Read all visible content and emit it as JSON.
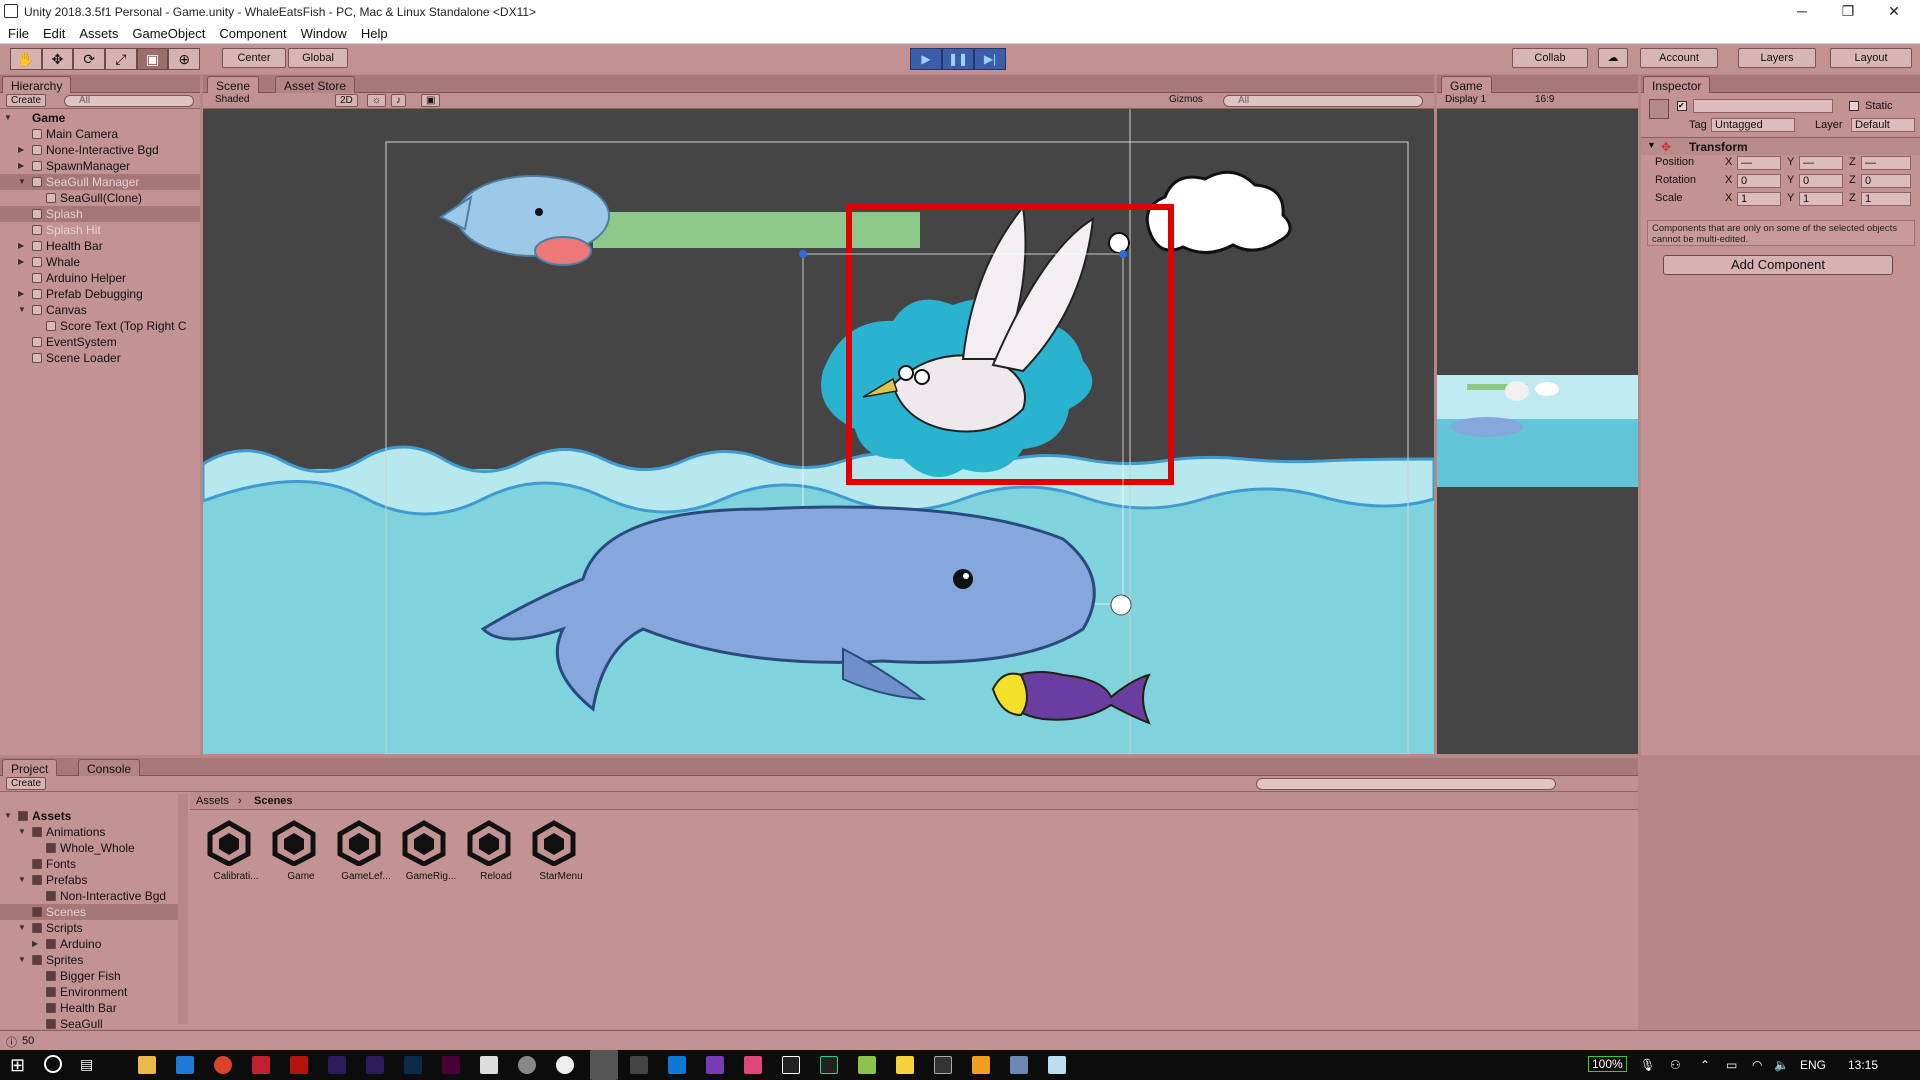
{
  "titlebar": {
    "title": "Unity 2018.3.5f1 Personal - Game.unity - WhaleEatsFish - PC, Mac & Linux Standalone <DX11>",
    "minimize": "─",
    "restore": "❐",
    "close": "✕"
  },
  "menu": [
    "File",
    "Edit",
    "Assets",
    "GameObject",
    "Component",
    "Window",
    "Help"
  ],
  "toolbar": {
    "tools": [
      "✋",
      "✥",
      "⟳",
      "⤢",
      "▣",
      "⊕"
    ],
    "center": "Center",
    "global": "Global",
    "play": "▶",
    "pause": "❚❚",
    "step": "▶|",
    "collab": "Collab",
    "account": "Account",
    "layers": "Layers",
    "layout": "Layout"
  },
  "hierarchy": {
    "tab": "Hierarchy",
    "create": "Create",
    "search_placeholder": "All",
    "scene": "Game",
    "items": [
      {
        "label": "Main Camera",
        "depth": 1,
        "arrow": ""
      },
      {
        "label": "None-Interactive Bgd",
        "depth": 1,
        "arrow": "▶"
      },
      {
        "label": "SpawnManager",
        "depth": 1,
        "arrow": "▶"
      },
      {
        "label": "SeaGull Manager",
        "depth": 1,
        "arrow": "▼",
        "selected": true,
        "grey": true
      },
      {
        "label": "SeaGull(Clone)",
        "depth": 2,
        "arrow": ""
      },
      {
        "label": "Splash",
        "depth": 1,
        "arrow": "",
        "selected": true,
        "grey": true
      },
      {
        "label": "Splash Hit",
        "depth": 1,
        "arrow": "",
        "grey": true
      },
      {
        "label": "Health Bar",
        "depth": 1,
        "arrow": "▶"
      },
      {
        "label": "Whale",
        "depth": 1,
        "arrow": "▶"
      },
      {
        "label": "Arduino Helper",
        "depth": 1,
        "arrow": ""
      },
      {
        "label": "Prefab Debugging",
        "depth": 1,
        "arrow": "▶"
      },
      {
        "label": "Canvas",
        "depth": 1,
        "arrow": "▼"
      },
      {
        "label": "Score Text (Top Right C",
        "depth": 2,
        "arrow": ""
      },
      {
        "label": "EventSystem",
        "depth": 1,
        "arrow": ""
      },
      {
        "label": "Scene Loader",
        "depth": 1,
        "arrow": ""
      }
    ]
  },
  "scene": {
    "tab": "Scene",
    "tab2": "Asset Store",
    "shading": "Shaded",
    "mode2d": "2D",
    "gizmos": "Gizmos",
    "search_placeholder": "All"
  },
  "game": {
    "tab": "Game",
    "display": "Display 1",
    "aspect": "16:9"
  },
  "inspector": {
    "tab": "Inspector",
    "static": "Static",
    "tag_label": "Tag",
    "tag": "Untagged",
    "layer_label": "Layer",
    "layer": "Default",
    "transform": "Transform",
    "rows": [
      {
        "label": "Position",
        "x": "—",
        "y": "—",
        "z": "—"
      },
      {
        "label": "Rotation",
        "x": "0",
        "y": "0",
        "z": "0"
      },
      {
        "label": "Scale",
        "x": "1",
        "y": "1",
        "z": "1"
      }
    ],
    "axes": {
      "x": "X",
      "y": "Y",
      "z": "Z"
    },
    "note": "Components that are only on some of the selected objects cannot be multi-edited.",
    "add_component": "Add Component"
  },
  "project": {
    "tab": "Project",
    "tab2": "Console",
    "create": "Create",
    "tree": [
      {
        "label": "Assets",
        "depth": 0,
        "arrow": "▼",
        "bold": true
      },
      {
        "label": "Animations",
        "depth": 1,
        "arrow": "▼"
      },
      {
        "label": "Whole_Whole",
        "depth": 2,
        "arrow": ""
      },
      {
        "label": "Fonts",
        "depth": 1,
        "arrow": ""
      },
      {
        "label": "Prefabs",
        "depth": 1,
        "arrow": "▼"
      },
      {
        "label": "Non-Interactive Bgd",
        "depth": 2,
        "arrow": ""
      },
      {
        "label": "Scenes",
        "depth": 1,
        "arrow": "",
        "selected": true,
        "grey": true
      },
      {
        "label": "Scripts",
        "depth": 1,
        "arrow": "▼"
      },
      {
        "label": "Arduino",
        "depth": 2,
        "arrow": "▶"
      },
      {
        "label": "Sprites",
        "depth": 1,
        "arrow": "▼"
      },
      {
        "label": "Bigger Fish",
        "depth": 2,
        "arrow": ""
      },
      {
        "label": "Environment",
        "depth": 2,
        "arrow": ""
      },
      {
        "label": "Health Bar",
        "depth": 2,
        "arrow": ""
      },
      {
        "label": "SeaGull",
        "depth": 2,
        "arrow": ""
      }
    ],
    "breadcrumb": [
      "Assets",
      "Scenes"
    ],
    "assets": [
      "Calibrati...",
      "Game",
      "GameLef...",
      "GameRig...",
      "Reload",
      "StarMenu"
    ]
  },
  "status": {
    "count": "50"
  },
  "taskbar": {
    "battery": "100%",
    "lang": "ENG",
    "time": "13:15"
  },
  "colors": {
    "accent_red": "#e00000",
    "health_green": "#8fc98a",
    "water": "#7fd3dd"
  }
}
